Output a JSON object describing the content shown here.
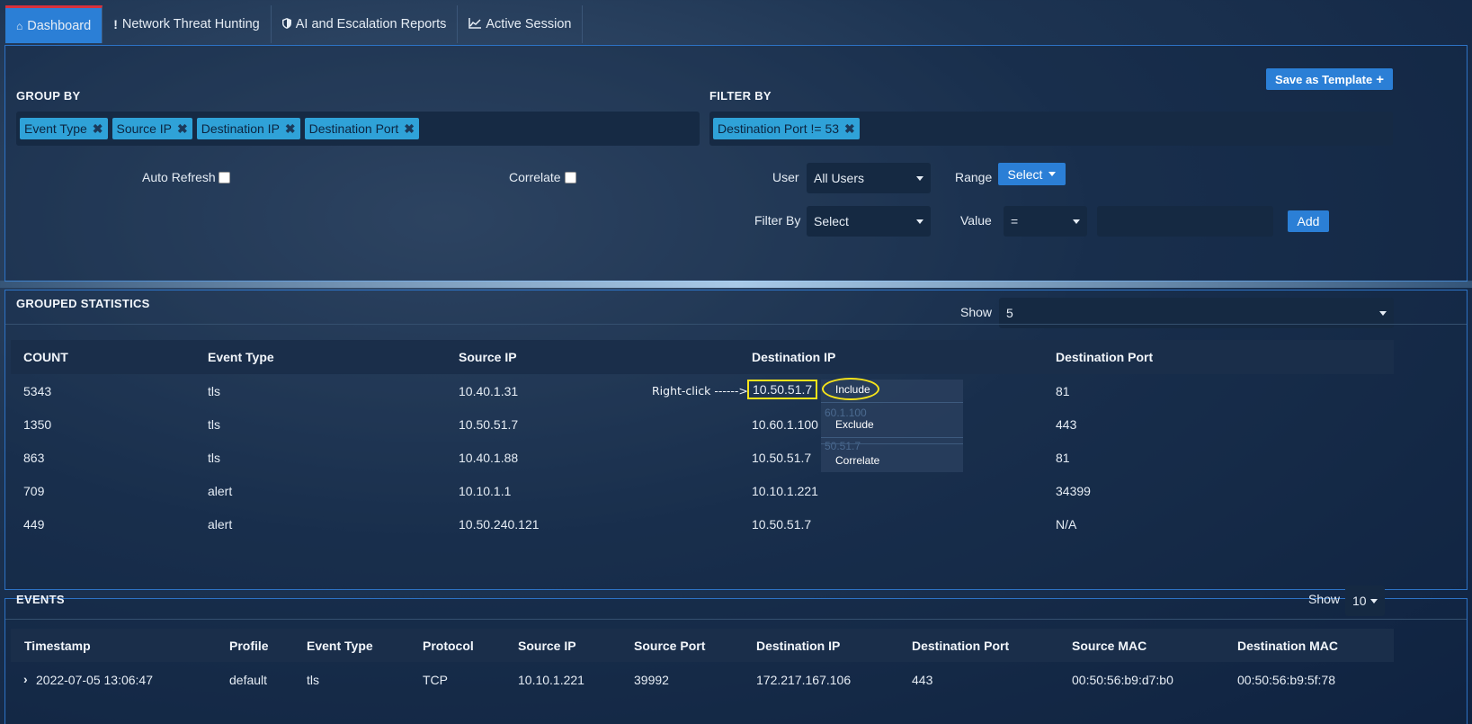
{
  "tabs": [
    {
      "label": "Dashboard",
      "icon": "home-icon"
    },
    {
      "label": "Network Threat Hunting",
      "icon": "exclamation-icon"
    },
    {
      "label": "AI and Escalation Reports",
      "icon": "shield-icon"
    },
    {
      "label": "Active Session",
      "icon": "line-chart-icon"
    }
  ],
  "toolbar": {
    "save_template_label": "Save as Template"
  },
  "group_by": {
    "label": "GROUP BY",
    "tags": [
      "Event Type",
      "Source IP",
      "Destination IP",
      "Destination Port"
    ]
  },
  "filter_by": {
    "label": "FILTER BY",
    "tags": [
      "Destination Port != 53"
    ]
  },
  "controls": {
    "auto_refresh_label": "Auto Refresh",
    "correlate_label": "Correlate",
    "user_label": "User",
    "user_value": "All Users",
    "range_label": "Range",
    "range_button": "Select",
    "filter_by_label": "Filter By",
    "filter_by_value": "Select",
    "value_label": "Value",
    "value_operator": "=",
    "value_input": "",
    "add_label": "Add"
  },
  "grouped_statistics": {
    "title": "GROUPED STATISTICS",
    "show_label": "Show",
    "show_value": "5",
    "columns": [
      "COUNT",
      "Event Type",
      "Source IP",
      "Destination IP",
      "Destination Port"
    ],
    "rows": [
      [
        "5343",
        "tls",
        "10.40.1.31",
        "10.50.51.7",
        "81"
      ],
      [
        "1350",
        "tls",
        "10.50.51.7",
        "10.60.1.100",
        "443"
      ],
      [
        "863",
        "tls",
        "10.40.1.88",
        "10.50.51.7",
        "81"
      ],
      [
        "709",
        "alert",
        "10.10.1.1",
        "10.10.1.221",
        "34399"
      ],
      [
        "449",
        "alert",
        "10.50.240.121",
        "10.50.51.7",
        "N/A"
      ]
    ]
  },
  "annotation": {
    "text": "Right-click ------>"
  },
  "context_menu": {
    "items": [
      "Include",
      "Exclude",
      "Correlate"
    ],
    "ghost_texts": [
      "60.1.100",
      "50.51.7"
    ]
  },
  "events": {
    "title": "EVENTS",
    "show_label": "Show",
    "show_value": "10",
    "columns": [
      "Timestamp",
      "Profile",
      "Event Type",
      "Protocol",
      "Source IP",
      "Source Port",
      "Destination IP",
      "Destination Port",
      "Source MAC",
      "Destination MAC"
    ],
    "rows": [
      [
        "2022-07-05 13:06:47",
        "default",
        "tls",
        "TCP",
        "10.10.1.221",
        "39992",
        "172.217.167.106",
        "443",
        "00:50:56:b9:d7:b0",
        "00:50:56:b9:5f:78"
      ]
    ]
  },
  "colors": {
    "accent": "#2b7fd6",
    "tag": "#2fa2d8",
    "highlight": "#f5e31a",
    "active_tab_border": "#d8313d"
  }
}
